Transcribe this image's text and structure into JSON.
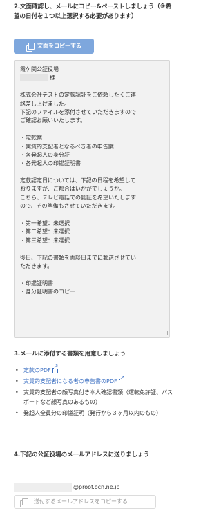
{
  "step2": {
    "title": "2.文面確認し、メールにコピー&ペーストしましょう（※希望の日付を１つ以上選択する必要があります）",
    "copy_button_label": "文面をコピーする",
    "copy_icon": "copy-icon"
  },
  "letter": {
    "lines": [
      "霞ケ関公証役場",
      "様",
      "",
      "株式会社テストの定款認証をご依頼したくご連",
      "絡差し上げました。",
      "下記のファイルを添付させていただきますので",
      "ご確認お願いいたします。",
      "",
      "・定款案",
      "・実質的支配者となるべき者の申告案",
      "・各発起人の身分証",
      "・各発起人の印鑑証明書",
      "",
      "定款認定日については、下記の日程を希望して",
      "おりますが、ご都合はいかがでしょうか。",
      "こちら、テレビ電話での認証を希望いたします",
      "ので、その準備もさせていただきます。",
      "",
      "・第一希望：未選択",
      "・第二希望：未選択",
      "・第三希望：未選択",
      "",
      "後日、下記の書類を面談日までに郵送させてい",
      "ただきます。",
      "",
      "・印鑑証明書",
      "・身分証明書のコピー"
    ]
  },
  "step3": {
    "title": "3.メールに添付する書類を用意しましょう",
    "items": [
      {
        "text": "定款のPDF",
        "is_link": true
      },
      {
        "text": "実質的支配者になる者の申告書のPDF",
        "is_link": true
      },
      {
        "text": "実質的支配者の顔写真付き本人確認書類（運転免許証、パスポートなど顔写真のあるもの）",
        "is_link": false
      },
      {
        "text": "発起人全員分の印鑑証明（発行から３ヶ月以内のもの）",
        "is_link": false
      }
    ]
  },
  "step4": {
    "title": "4.下記の公証役場のメールアドレスに送りましょう",
    "email_domain": "@proof.ocn.ne.jp",
    "copy_address_label": "送付するメールアドレスをコピーする"
  },
  "colors": {
    "primary_button": "#7ea7dd",
    "link": "#3b6fc2",
    "textarea_bg": "#f2f2f2"
  }
}
